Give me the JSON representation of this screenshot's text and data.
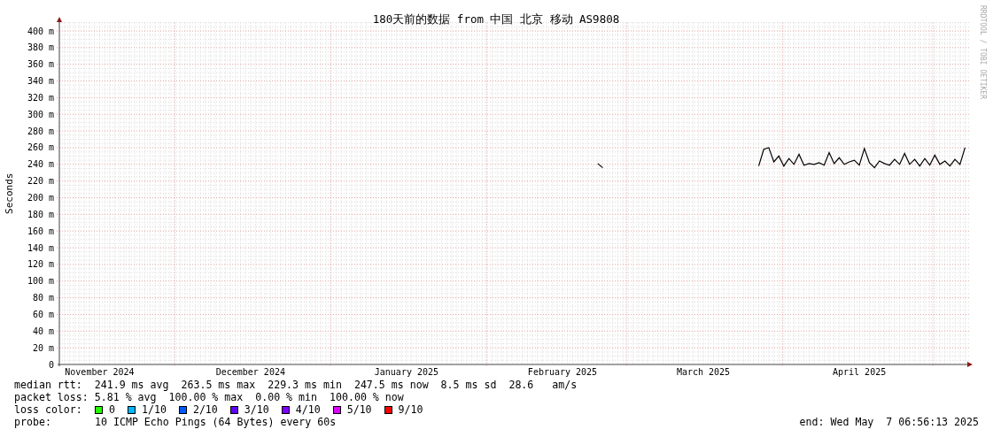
{
  "graph": {
    "title": "180天前的数据 from 中国 北京 移动 AS9808",
    "watermark": "RRDTOOL / TOBI OETIKER",
    "chart_data": {
      "type": "line",
      "ylabel": "Seconds",
      "grid": true,
      "ylim": [
        0,
        410
      ],
      "yticks": [
        {
          "value": 0,
          "label": "0"
        },
        {
          "value": 20,
          "label": "20 m"
        },
        {
          "value": 40,
          "label": "40 m"
        },
        {
          "value": 60,
          "label": "60 m"
        },
        {
          "value": 80,
          "label": "80 m"
        },
        {
          "value": 100,
          "label": "100 m"
        },
        {
          "value": 120,
          "label": "120 m"
        },
        {
          "value": 140,
          "label": "140 m"
        },
        {
          "value": 160,
          "label": "160 m"
        },
        {
          "value": 180,
          "label": "180 m"
        },
        {
          "value": 200,
          "label": "200 m"
        },
        {
          "value": 220,
          "label": "220 m"
        },
        {
          "value": 240,
          "label": "240 m"
        },
        {
          "value": 260,
          "label": "260 m"
        },
        {
          "value": 280,
          "label": "280 m"
        },
        {
          "value": 300,
          "label": "300 m"
        },
        {
          "value": 320,
          "label": "320 m"
        },
        {
          "value": 340,
          "label": "340 m"
        },
        {
          "value": 360,
          "label": "360 m"
        },
        {
          "value": 380,
          "label": "380 m"
        },
        {
          "value": 400,
          "label": "400 m"
        }
      ],
      "categories": [
        null,
        null,
        null,
        null,
        null,
        null,
        null,
        null,
        "November 2024",
        null,
        null,
        null,
        null,
        null,
        null,
        null,
        null,
        null,
        null,
        null,
        null,
        null,
        null,
        null,
        null,
        null,
        null,
        null,
        null,
        null,
        null,
        null,
        null,
        null,
        null,
        null,
        null,
        null,
        "December 2024",
        null,
        null,
        null,
        null,
        null,
        null,
        null,
        null,
        null,
        null,
        null,
        null,
        null,
        null,
        null,
        null,
        null,
        null,
        null,
        null,
        null,
        null,
        null,
        null,
        null,
        null,
        null,
        null,
        null,
        null,
        "January 2025",
        null,
        null,
        null,
        null,
        null,
        null,
        null,
        null,
        null,
        null,
        null,
        null,
        null,
        null,
        null,
        null,
        null,
        null,
        null,
        null,
        null,
        null,
        null,
        null,
        null,
        null,
        null,
        null,
        null,
        null,
        "February 2025",
        null,
        null,
        null,
        null,
        null,
        null,
        null,
        null,
        null,
        null,
        null,
        null,
        null,
        null,
        null,
        null,
        null,
        null,
        null,
        null,
        null,
        null,
        null,
        null,
        null,
        null,
        null,
        "March 2025",
        null,
        null,
        null,
        null,
        null,
        null,
        null,
        null,
        null,
        null,
        null,
        null,
        null,
        null,
        null,
        null,
        null,
        null,
        null,
        null,
        null,
        null,
        null,
        null,
        null,
        null,
        null,
        null,
        null,
        null,
        "April 2025",
        null,
        null,
        null,
        null,
        null,
        null,
        null,
        null,
        null,
        null,
        null,
        null,
        null,
        null,
        null,
        null,
        null,
        null,
        null,
        null,
        null
      ],
      "series": [
        {
          "color": "#000000",
          "values": [
            null,
            null,
            null,
            null,
            null,
            null,
            null,
            null,
            null,
            null,
            null,
            null,
            null,
            null,
            null,
            null,
            null,
            null,
            null,
            null,
            null,
            null,
            null,
            null,
            null,
            null,
            null,
            null,
            null,
            null,
            null,
            null,
            null,
            null,
            null,
            null,
            null,
            null,
            null,
            null,
            null,
            null,
            null,
            null,
            null,
            null,
            null,
            null,
            null,
            null,
            null,
            null,
            null,
            null,
            null,
            null,
            null,
            null,
            null,
            null,
            null,
            null,
            null,
            null,
            null,
            null,
            null,
            null,
            null,
            null,
            null,
            null,
            null,
            null,
            null,
            null,
            null,
            null,
            null,
            null,
            null,
            null,
            null,
            null,
            null,
            null,
            null,
            null,
            null,
            null,
            null,
            null,
            null,
            null,
            null,
            null,
            null,
            null,
            null,
            null,
            null,
            null,
            null,
            null,
            null,
            null,
            null,
            241,
            236,
            null,
            null,
            null,
            null,
            null,
            null,
            null,
            null,
            null,
            null,
            null,
            null,
            null,
            null,
            null,
            null,
            null,
            null,
            null,
            null,
            null,
            null,
            null,
            null,
            null,
            null,
            null,
            null,
            null,
            null,
            238,
            258,
            260,
            243,
            250,
            238,
            247,
            240,
            252,
            239,
            241,
            240,
            242,
            239,
            254,
            241,
            248,
            240,
            243,
            245,
            239,
            259,
            242,
            236,
            244,
            241,
            239,
            246,
            240,
            253,
            240,
            246,
            238,
            247,
            239,
            251,
            240,
            244,
            238,
            246,
            240,
            260
          ]
        }
      ]
    }
  },
  "legend": {
    "lines": [
      "median rtt:  241.9 ms avg  263.5 ms max  229.3 ms min  247.5 ms now  8.5 ms sd  28.6   am/s",
      "packet loss: 5.81 % avg  100.00 % max  0.00 % min  100.00 % now"
    ],
    "loss_label": "loss color:",
    "loss_colors": [
      {
        "label": "0",
        "color": "#26ff00"
      },
      {
        "label": "1/10",
        "color": "#00b8ff"
      },
      {
        "label": "2/10",
        "color": "#0059ff"
      },
      {
        "label": "3/10",
        "color": "#5e00ff"
      },
      {
        "label": "4/10",
        "color": "#7e00ff"
      },
      {
        "label": "5/10",
        "color": "#dd00ff"
      },
      {
        "label": "9/10",
        "color": "#ff0000"
      }
    ],
    "probe_label": "probe:",
    "probe": "10 ICMP Echo Pings (64 Bytes) every 60s",
    "end": "end: Wed May  7 06:56:13 2025"
  }
}
